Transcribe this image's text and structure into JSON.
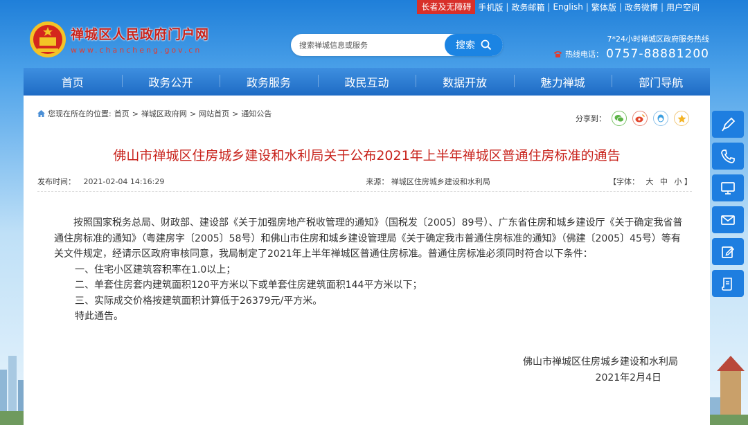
{
  "toplinks": {
    "accessible": "长者及无障碍",
    "links": [
      "手机版",
      "政务邮箱",
      "English",
      "繁体版",
      "政务微博",
      "用户空间"
    ]
  },
  "logo": {
    "title": "禅城区人民政府门户网",
    "domain": "www.chancheng.gov.cn"
  },
  "search": {
    "placeholder": "搜索禅城信息或服务",
    "button_label": "搜索"
  },
  "hotline": {
    "caption": "7*24小时禅城区政府服务热线",
    "label": "热线电话：",
    "number": "0757-88881200"
  },
  "nav": {
    "items": [
      "首页",
      "政务公开",
      "政务服务",
      "政民互动",
      "数据开放",
      "魅力禅城",
      "部门导航"
    ]
  },
  "breadcrumb": {
    "prefix": "您现在所在的位置:",
    "items": [
      "首页",
      "禅城区政府网",
      "网站首页",
      "通知公告"
    ],
    "separator": ">"
  },
  "share": {
    "label": "分享到："
  },
  "article": {
    "title": "佛山市禅城区住房城乡建设和水利局关于公布2021年上半年禅城区普通住房标准的通告",
    "publish_label": "发布时间：",
    "publish_time": "2021-02-04 14:16:29",
    "source_label": "来源：",
    "source": "禅城区住房城乡建设和水利局",
    "font_label": "【字体：",
    "font_sizes": [
      "大",
      "中",
      "小"
    ],
    "font_close": "】",
    "paragraph": "按照国家税务总局、财政部、建设部《关于加强房地产税收管理的通知》（国税发〔2005〕89号）、广东省住房和城乡建设厅《关于确定我省普通住房标准的通知》（粤建房字〔2005〕58号）和佛山市住房和城乡建设管理局《关于确定我市普通住房标准的通知》（佛建〔2005〕45号）等有关文件规定，经请示区政府审核同意，我局制定了2021年上半年禅城区普通住房标准。普通住房标准必须同时符合以下条件：",
    "conditions": [
      "一、住宅小区建筑容积率在1.0以上；",
      "二、单套住房套内建筑面积120平方米以下或单套住房建筑面积144平方米以下；",
      "三、实际成交价格按建筑面积计算低于26379元/平方米。"
    ],
    "closing": "特此通告。",
    "signature": "佛山市禅城区住房城乡建设和水利局",
    "date": "2021年2月4日"
  },
  "side_tools": [
    "pen-icon",
    "phone-icon",
    "monitor-icon",
    "mail-icon",
    "edit-icon",
    "document-icon"
  ],
  "colors": {
    "nav_blue": "#2a78d2",
    "title_red": "#c8231c",
    "side_blue": "#1e7ee0",
    "accessible_red": "#d8302a"
  }
}
